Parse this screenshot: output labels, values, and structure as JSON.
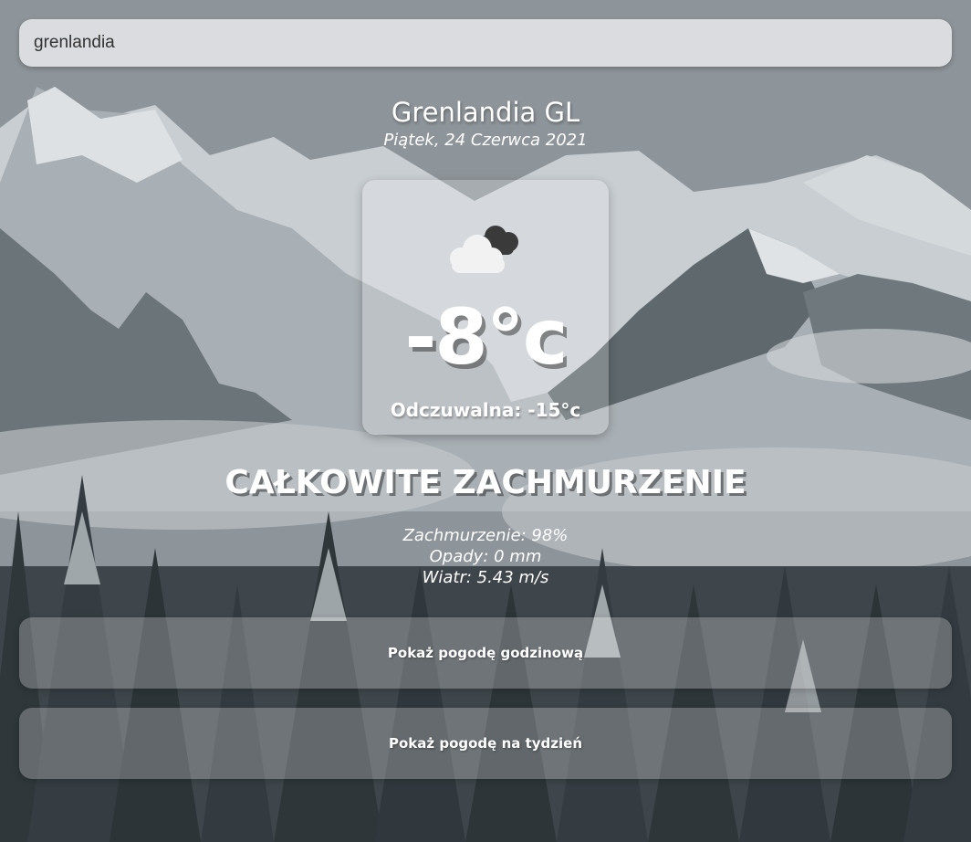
{
  "search": {
    "value": "grenlandia",
    "placeholder": ""
  },
  "location": {
    "name": "Grenlandia GL",
    "date": "Piątek, 24 Czerwca 2021"
  },
  "current": {
    "icon": "cloudy-icon",
    "temperature": "-8°c",
    "feels_like": "Odczuwalna: -15°c",
    "condition": "CAŁKOWITE ZACHMURZENIE"
  },
  "details": {
    "clouds": "Zachmurzenie: 98%",
    "precipitation": "Opady: 0 mm",
    "wind": "Wiatr: 5.43 m/s"
  },
  "actions": {
    "hourly_label": "Pokaż pogodę godzinową",
    "weekly_label": "Pokaż pogodę na tydzień"
  },
  "colors": {
    "card_bg": "#ffffff",
    "text": "#ffffff"
  }
}
